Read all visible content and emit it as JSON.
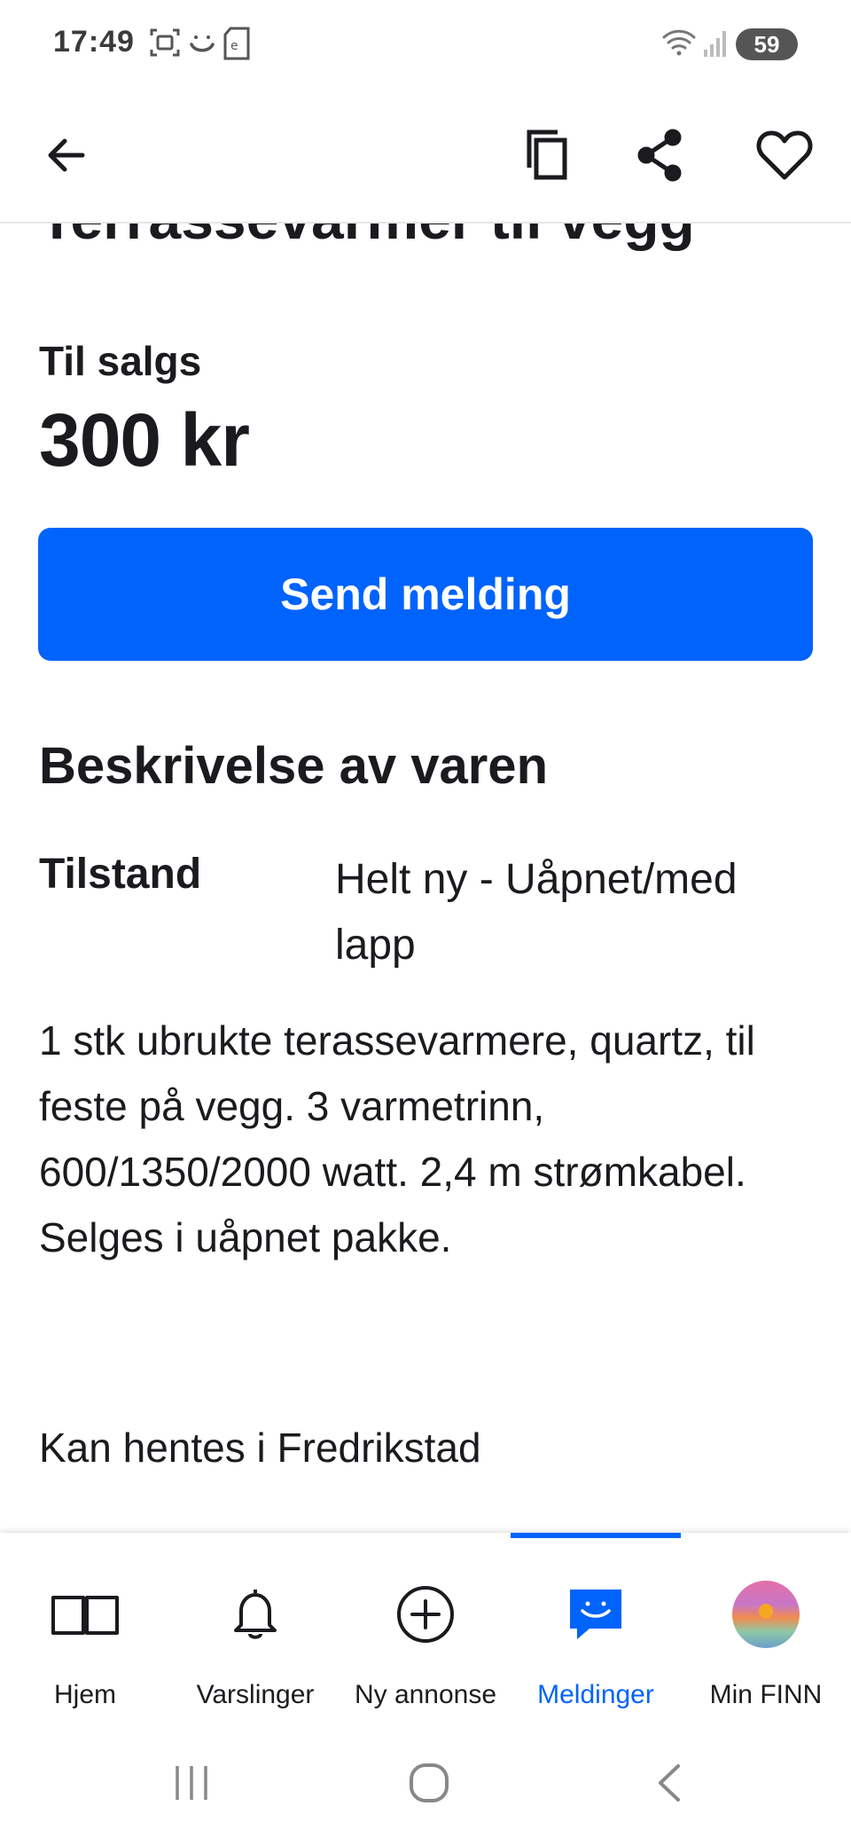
{
  "status_bar": {
    "time": "17:49",
    "battery": "59",
    "left_icons": [
      "screenshot-icon",
      "smile-icon",
      "sim-e-icon"
    ],
    "right_icons": [
      "wifi-icon",
      "signal-icon"
    ]
  },
  "app_bar": {
    "back_icon": "arrow-left-icon",
    "actions": [
      "copy-icon",
      "share-icon",
      "heart-icon"
    ]
  },
  "listing": {
    "title": "Terrassevarmer til vegg",
    "for_sale_label": "Til salgs",
    "price": "300 kr",
    "send_button": "Send melding",
    "description_heading": "Beskrivelse av varen",
    "condition_label": "Tilstand",
    "condition_value": "Helt ny - Uåpnet/med lapp",
    "description": "1 stk ubrukte terassevarmere, quartz, til feste på vegg. 3 varmetrinn, 600/1350/2000 watt. 2,4 m strømkabel. Selges i uåpnet pakke.",
    "pickup": "Kan hentes i Fredrikstad"
  },
  "bottom_nav": {
    "items": [
      {
        "label": "Hjem",
        "icon": "book-icon"
      },
      {
        "label": "Varslinger",
        "icon": "bell-icon"
      },
      {
        "label": "Ny annonse",
        "icon": "plus-circle-icon"
      },
      {
        "label": "Meldinger",
        "icon": "chat-icon"
      },
      {
        "label": "Min FINN",
        "icon": "avatar"
      }
    ],
    "active_index": 3
  },
  "colors": {
    "accent": "#0063fb",
    "text": "#1b1b1f"
  }
}
